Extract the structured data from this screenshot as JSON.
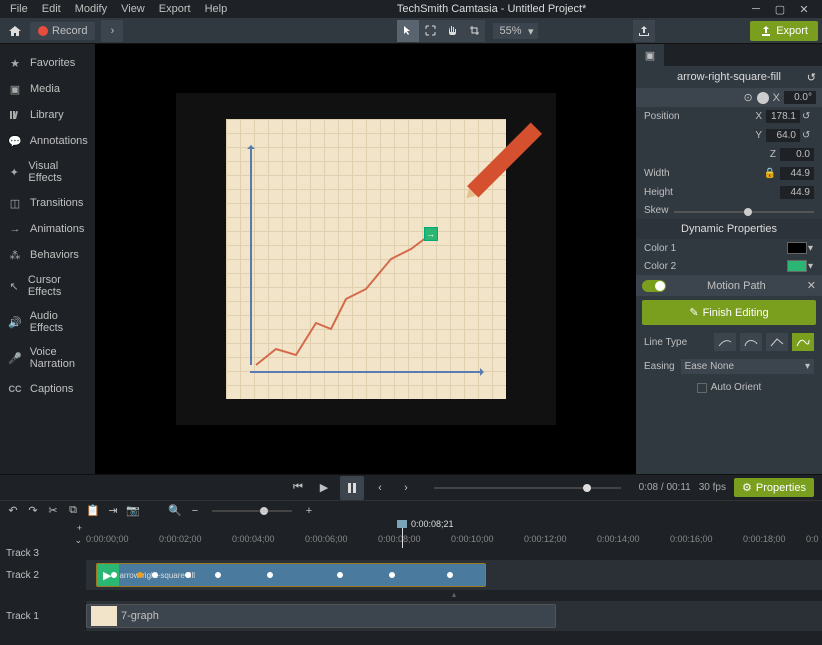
{
  "menubar": {
    "items": [
      "File",
      "Edit",
      "Modify",
      "View",
      "Export",
      "Help"
    ],
    "title": "TechSmith Camtasia - Untitled Project*"
  },
  "toolbar": {
    "record": "Record",
    "zoom": "55%",
    "export": "Export"
  },
  "sidebar": {
    "items": [
      {
        "icon": "star",
        "label": "Favorites"
      },
      {
        "icon": "media",
        "label": "Media"
      },
      {
        "icon": "library",
        "label": "Library"
      },
      {
        "icon": "annotation",
        "label": "Annotations"
      },
      {
        "icon": "sparkle",
        "label": "Visual Effects"
      },
      {
        "icon": "transition",
        "label": "Transitions"
      },
      {
        "icon": "animation",
        "label": "Animations"
      },
      {
        "icon": "behavior",
        "label": "Behaviors"
      },
      {
        "icon": "cursor",
        "label": "Cursor Effects"
      },
      {
        "icon": "audio",
        "label": "Audio Effects"
      },
      {
        "icon": "mic",
        "label": "Voice Narration"
      },
      {
        "icon": "cc",
        "label": "Captions"
      }
    ]
  },
  "props": {
    "object_name": "arrow-right-square-fill",
    "xform_x_label": "X",
    "xform_x_val": "0.0°",
    "position_label": "Position",
    "pos_x_label": "X",
    "pos_x": "178.1",
    "pos_y_label": "Y",
    "pos_y": "64.0",
    "pos_z_label": "Z",
    "pos_z": "0.0",
    "width_label": "Width",
    "width": "44.9",
    "height_label": "Height",
    "height": "44.9",
    "skew_label": "Skew",
    "dyn_header": "Dynamic Properties",
    "color1_label": "Color 1",
    "color1": "#000000",
    "color2_label": "Color 2",
    "color2": "#2bb673",
    "motion_header": "Motion Path",
    "finish_label": "Finish Editing",
    "linetype_label": "Line Type",
    "easing_label": "Easing",
    "easing_val": "Ease None",
    "auto_orient": "Auto Orient"
  },
  "playback": {
    "time": "0:08 / 00:11",
    "fps": "30 fps",
    "props_btn": "Properties"
  },
  "timeline": {
    "playhead_time": "0:00:08;21",
    "ticks": [
      "0:00:00;00",
      "0:00:02;00",
      "0:00:04;00",
      "0:00:06;00",
      "0:00:08;00",
      "0:00:10;00",
      "0:00:12;00",
      "0:00:14;00",
      "0:00:16;00",
      "0:00:18;00",
      "0:0"
    ],
    "track3": "Track 3",
    "track2": "Track 2",
    "track1": "Track 1",
    "clip2_label": "arrow-right-square-fill",
    "clip1_label": "7-graph"
  }
}
